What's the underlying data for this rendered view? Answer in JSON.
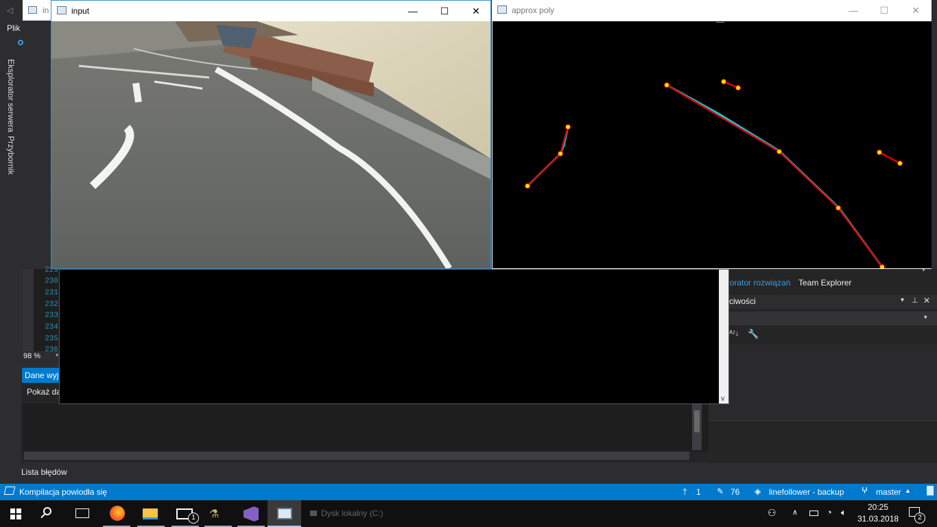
{
  "vs": {
    "menu_first": "Plik",
    "vertical_tabs": [
      "Eksplorator serwera",
      "Przybornik"
    ],
    "hidden_window_tab": "in",
    "line_numbers": [
      "229",
      "230",
      "231",
      "232",
      "233",
      "234",
      "235",
      "236"
    ],
    "zoom": "98 %",
    "output_tab": "Dane wyj",
    "output_show_label": "Pokaż da",
    "error_list_label": "Lista błędów",
    "right_tabs": [
      "lorator rozwiązań",
      "Team Explorer"
    ],
    "properties_title": "ciwości"
  },
  "input_window": {
    "title": "input"
  },
  "approx_window": {
    "title": "approx poly"
  },
  "statusbar": {
    "message": "Kompilacja powiodła się",
    "up_count": "1",
    "pencil_count": "76",
    "repo": "linefollower - backup",
    "branch": "master"
  },
  "taskbar": {
    "drive_label": "Dysk lokalny (C:)",
    "mail_badge": "1",
    "time": "20:25",
    "date": "31.03.2018",
    "notification_count": "2"
  },
  "colors": {
    "accent": "#007acc",
    "cyan": "#00d0e0",
    "red": "#e00000",
    "yellow": "#ffe000"
  }
}
